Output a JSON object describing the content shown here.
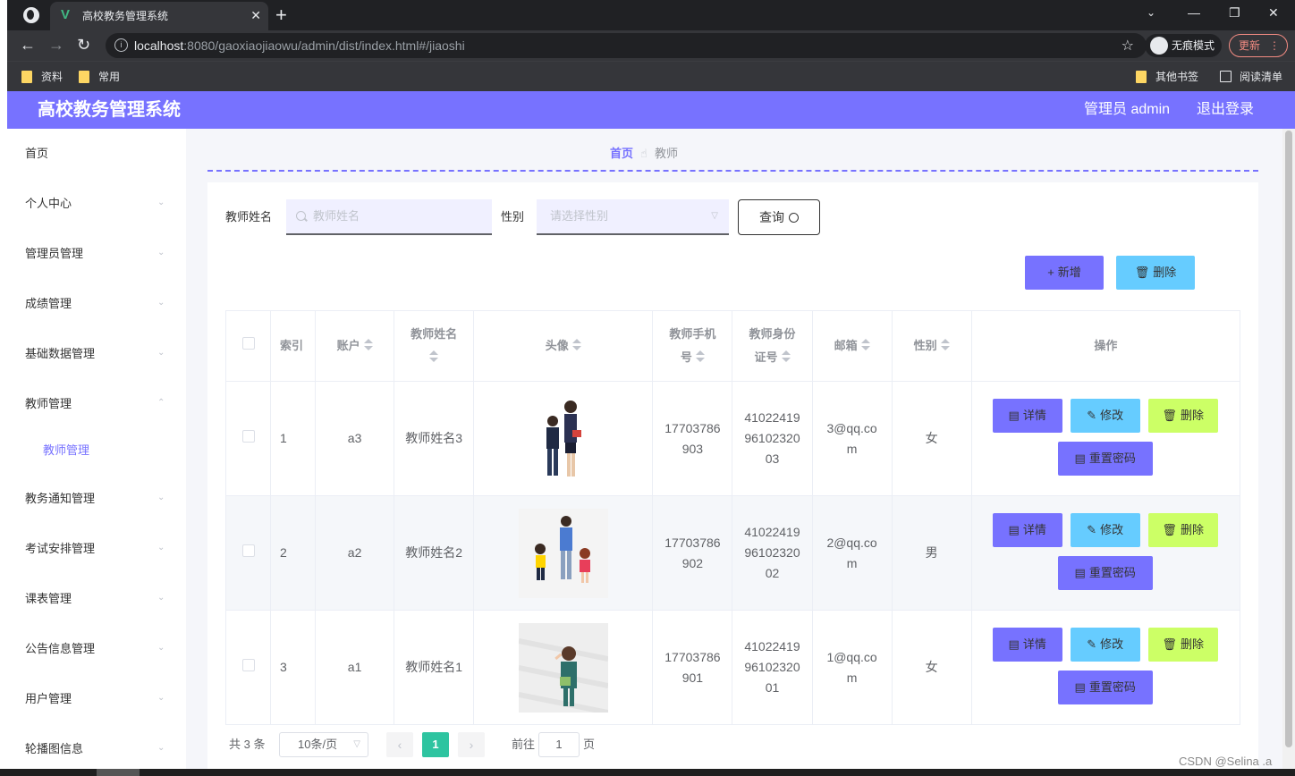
{
  "browser": {
    "tab_title": "高校教务管理系统",
    "url_host": "localhost",
    "url_rest": ":8080/gaoxiaojiaowu/admin/dist/index.html#/jiaoshi",
    "incognito_label": "无痕模式",
    "update_label": "更新",
    "bookmarks": [
      "资料",
      "常用"
    ],
    "bookmarks_right": [
      "其他书签",
      "阅读清单"
    ]
  },
  "header": {
    "title": "高校教务管理系统",
    "user": "管理员 admin",
    "logout": "退出登录",
    "color": "#7772ff"
  },
  "sidebar": {
    "items": [
      {
        "label": "首页",
        "has_arrow": false
      },
      {
        "label": "个人中心",
        "has_arrow": true
      },
      {
        "label": "管理员管理",
        "has_arrow": true
      },
      {
        "label": "成绩管理",
        "has_arrow": true
      },
      {
        "label": "基础数据管理",
        "has_arrow": true
      },
      {
        "label": "教师管理",
        "has_arrow": true,
        "expanded": true
      },
      {
        "label": "教务通知管理",
        "has_arrow": true
      },
      {
        "label": "考试安排管理",
        "has_arrow": true
      },
      {
        "label": "课表管理",
        "has_arrow": true
      },
      {
        "label": "公告信息管理",
        "has_arrow": true
      },
      {
        "label": "用户管理",
        "has_arrow": true
      },
      {
        "label": "轮播图信息",
        "has_arrow": true
      }
    ],
    "sub_item": "教师管理"
  },
  "breadcrumb": {
    "home": "首页",
    "current": "教师"
  },
  "search": {
    "name_label": "教师姓名",
    "name_placeholder": "教师姓名",
    "gender_label": "性别",
    "gender_placeholder": "请选择性别",
    "query_label": "查询"
  },
  "actions": {
    "add_label": "新增",
    "delete_label": "删除"
  },
  "table": {
    "headers": {
      "index": "索引",
      "account": "账户",
      "name_line1": "教师姓名",
      "avatar": "头像",
      "phone_line1": "教师手机",
      "phone_line2": "号",
      "id_line1": "教师身份",
      "id_line2": "证号",
      "email": "邮箱",
      "gender": "性别",
      "ops": "操作"
    },
    "rows": [
      {
        "index": "1",
        "account": "a3",
        "name": "教师姓名3",
        "phone1": "17703786",
        "phone2": "903",
        "id1": "41022419",
        "id2": "96102320",
        "id3": "03",
        "email1": "3@qq.co",
        "email2": "m",
        "gender": "女"
      },
      {
        "index": "2",
        "account": "a2",
        "name": "教师姓名2",
        "phone1": "17703786",
        "phone2": "902",
        "id1": "41022419",
        "id2": "96102320",
        "id3": "02",
        "email1": "2@qq.co",
        "email2": "m",
        "gender": "男"
      },
      {
        "index": "3",
        "account": "a1",
        "name": "教师姓名1",
        "phone1": "17703786",
        "phone2": "901",
        "id1": "41022419",
        "id2": "96102320",
        "id3": "01",
        "email1": "1@qq.co",
        "email2": "m",
        "gender": "女"
      }
    ],
    "op_labels": {
      "detail": "详情",
      "edit": "修改",
      "delete": "删除",
      "reset": "重置密码"
    }
  },
  "pagination": {
    "total": "共 3 条",
    "page_size": "10条/页",
    "current": "1",
    "goto_label": "前往",
    "goto_value": "1",
    "page_suffix": "页"
  },
  "watermark": "CSDN @Selina .a"
}
